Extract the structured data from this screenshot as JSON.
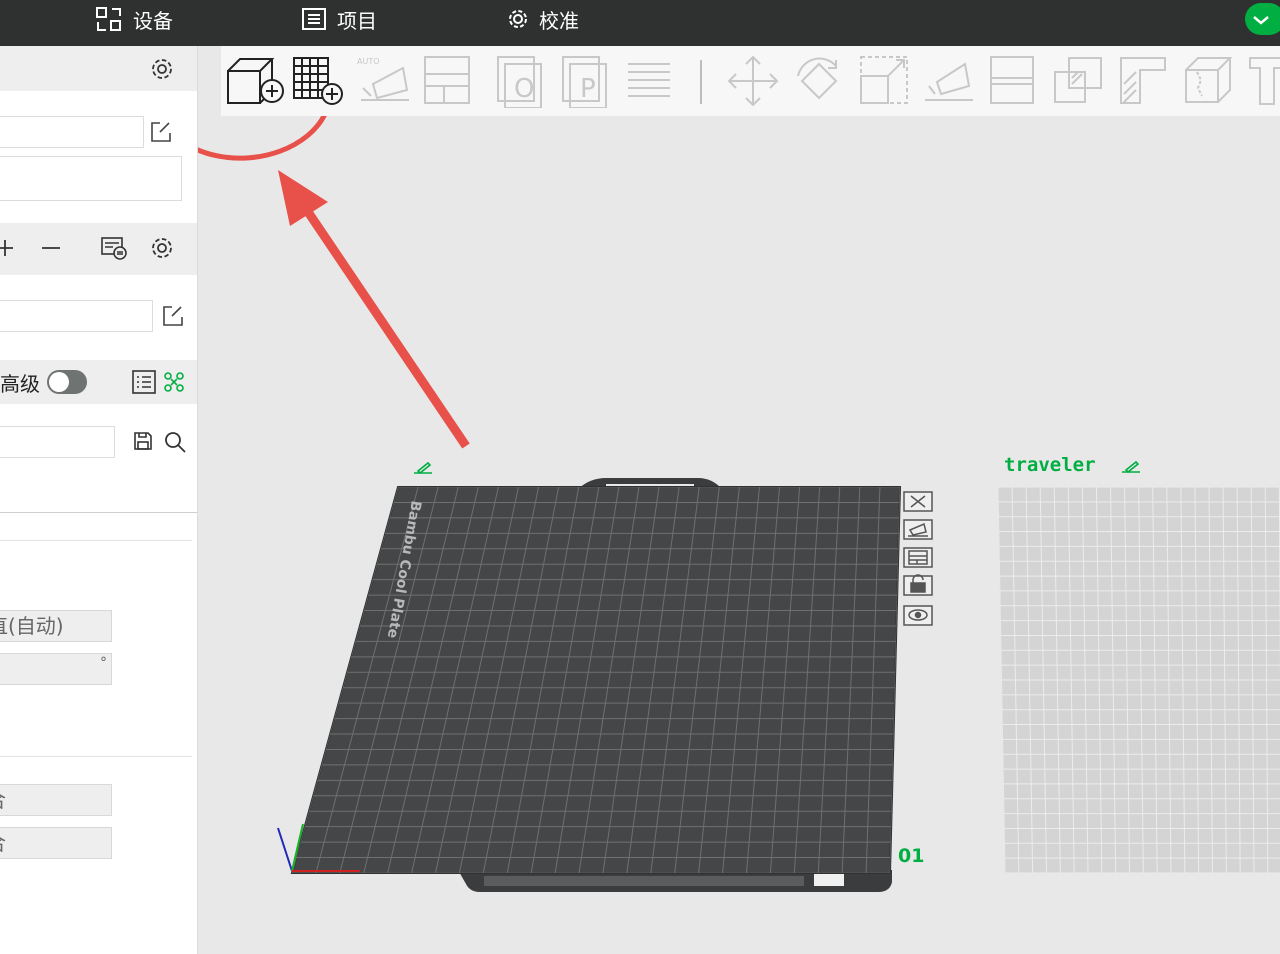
{
  "topbar": {
    "nav": [
      {
        "label": "设备",
        "icon": "device-icon"
      },
      {
        "label": "项目",
        "icon": "project-list-icon"
      },
      {
        "label": "校准",
        "icon": "calibration-icon"
      }
    ]
  },
  "sidebar": {
    "process": {
      "advanced_label": "高级",
      "advanced_on": false
    },
    "fields": {
      "auto_field_text": "直(自动)",
      "degree_unit": "°",
      "field_a": "合",
      "field_b": "合"
    }
  },
  "toolbar": {
    "tools": [
      "add-object-icon",
      "add-plate-icon",
      "auto-orient-icon",
      "arrange-icon",
      "split-objects-icon",
      "split-parts-icon",
      "layer-editing-icon",
      "move-icon",
      "rotate-icon",
      "scale-icon",
      "lay-on-face-icon",
      "cut-icon",
      "boolean-icon",
      "support-paint-icon",
      "seam-paint-icon",
      "text-icon"
    ]
  },
  "plates": {
    "plate1": {
      "name": "",
      "number": "01",
      "bed_text": "Bambu Cool Plate",
      "bed_color": "#444648",
      "grid_color": "#6e7070"
    },
    "plate2": {
      "name": "traveler",
      "bed_color": "#d4d4d4",
      "grid_color": "#ececec"
    },
    "plate_controls": [
      "close-plate-icon",
      "auto-orient-plate-icon",
      "arrange-plate-icon",
      "lock-plate-icon",
      "plate-settings-icon"
    ]
  },
  "colors": {
    "accent": "#00ae42",
    "topbar": "#2e3130",
    "annotation": "#e8504a"
  }
}
